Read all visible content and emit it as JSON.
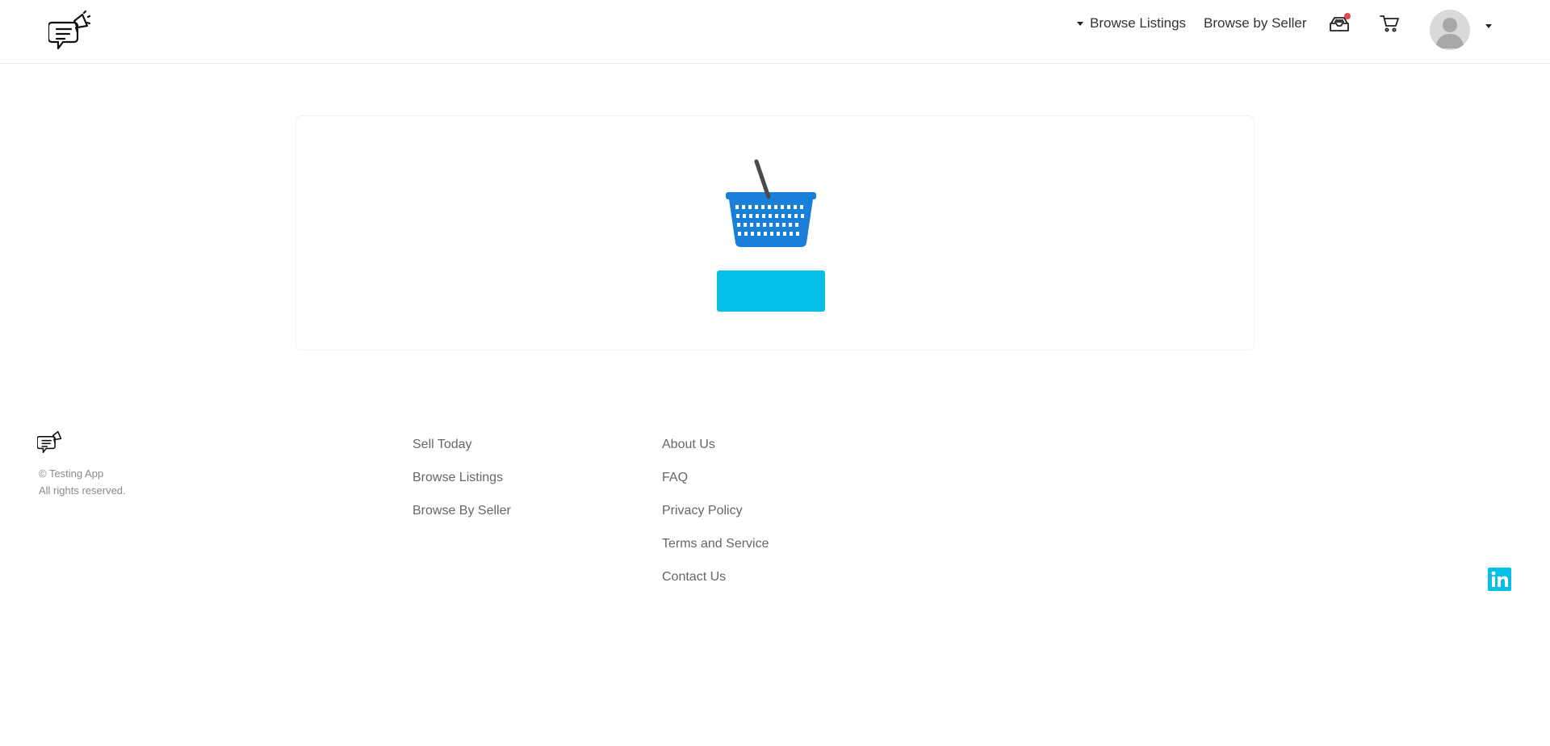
{
  "header": {
    "browse_listings_label": "Browse Listings",
    "browse_by_seller_label": "Browse by Seller",
    "icons": [
      "logo-icon",
      "inbox-icon",
      "cart-icon",
      "avatar",
      "chevron-down-icon"
    ],
    "notification_dot_color": "#e5484d"
  },
  "main": {
    "empty_cart_icon": "shopping-basket-icon",
    "cta_label": ""
  },
  "footer": {
    "copyright": "© Testing App",
    "rights": "All rights reserved.",
    "column1": [
      "Sell Today",
      "Browse Listings",
      "Browse By Seller"
    ],
    "column2": [
      "About Us",
      "FAQ",
      "Privacy Policy",
      "Terms and Service",
      "Contact Us"
    ],
    "social_icon": "linkedin-icon"
  },
  "colors": {
    "accent": "#06bfe6",
    "basket_blue": "#1a7fd8",
    "text": "#333333",
    "muted": "#8a8a8a"
  }
}
